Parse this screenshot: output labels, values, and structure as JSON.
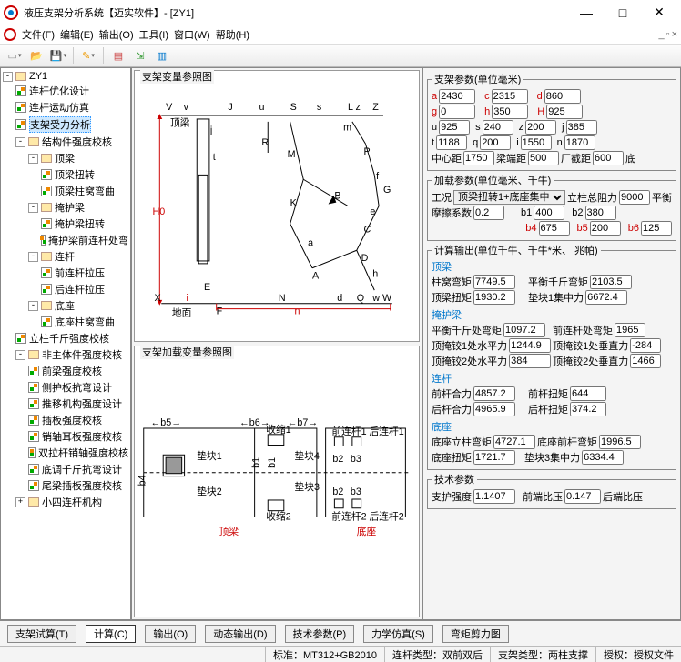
{
  "window": {
    "title": "液压支架分析系统【迈实软件】- [ZY1]"
  },
  "menu": {
    "file": "文件(F)",
    "edit": "编辑(E)",
    "output": "输出(O)",
    "tools": "工具(I)",
    "window": "窗口(W)",
    "help": "帮助(H)"
  },
  "tree": {
    "root": "ZY1",
    "n1": "连杆优化设计",
    "n2": "连杆运动仿真",
    "n3": "支架受力分析",
    "n4": "结构件强度校核",
    "n5": "顶梁",
    "n5a": "顶梁扭转",
    "n5b": "顶梁柱窝弯曲",
    "n6": "掩护梁",
    "n6a": "掩护梁扭转",
    "n6b": "掩护梁前连杆处弯",
    "n7": "连杆",
    "n7a": "前连杆拉压",
    "n7b": "后连杆拉压",
    "n8": "底座",
    "n8a": "底座柱窝弯曲",
    "n9": "立柱千斤强度校核",
    "n10": "非主体件强度校核",
    "n10a": "前梁强度校核",
    "n10b": "侧护板抗弯设计",
    "n10c": "推移机构强度设计",
    "n10d": "插板强度校核",
    "n10e": "销轴耳板强度校核",
    "n10f": "双拉杆销轴强度校核",
    "n10g": "底调千斤抗弯设计",
    "n10h": "尾梁插板强度校核",
    "n11": "小四连杆机构"
  },
  "captions": {
    "diag1": "支架变量参照图",
    "diag2": "支架加载变量参照图",
    "d1_top": "顶梁",
    "d1_bot": "地面",
    "d2a": "顶梁",
    "d2b": "底座"
  },
  "fs": {
    "p1": "支架参数(单位毫米)",
    "p2": "加载参数(单位毫米、千牛)",
    "p3": "计算输出(单位千牛、千牛*米、 兆帕)",
    "p3a": "顶梁",
    "p3b": "掩护梁",
    "p3c": "连杆",
    "p3d": "底座",
    "p4": "技术参数"
  },
  "lbl": {
    "a": "a",
    "c": "c",
    "d": "d",
    "g": "g",
    "h": "h",
    "H": "H",
    "u": "u",
    "s": "s",
    "z": "z",
    "j": "j",
    "t": "t",
    "q": "q",
    "i": "i",
    "n": "n",
    "center": "中心距",
    "beamEnd": "梁端距",
    "factoryEnd": "厂截距",
    "tail": "底",
    "cond": "工况",
    "colRes": "立柱总阻力",
    "balance": "平衡",
    "fric": "摩擦系数",
    "b1": "b1",
    "b2": "b2",
    "b4": "b4",
    "b5": "b5",
    "b6": "b6",
    "o1": "柱窝弯矩",
    "o2": "平衡千斤弯矩",
    "o3": "顶梁扭矩",
    "o4": "垫块1集中力",
    "o5": "平衡千斤处弯矩",
    "o6": "前连杆处弯矩",
    "o7": "顶掩铰1处水平力",
    "o8": "顶掩铰1处垂直力",
    "o9": "顶掩铰2处水平力",
    "o10": "顶掩铰2处垂直力",
    "o11": "前杆合力",
    "o12": "前杆扭矩",
    "o13": "后杆合力",
    "o14": "后杆扭矩",
    "o15": "底座立柱弯矩",
    "o16": "底座前杆弯矩",
    "o17": "底座扭矩",
    "o18": "垫块3集中力",
    "t1": "支护强度",
    "t2": "前端比压",
    "t3": "后端比压"
  },
  "val": {
    "a": "2430",
    "c": "2315",
    "d": "860",
    "g": "0",
    "h": "350",
    "H": "925",
    "u": "925",
    "s": "240",
    "z": "200",
    "j": "385",
    "t": "1188",
    "q": "200",
    "i": "1550",
    "n": "1870",
    "center": "1750",
    "beamEnd": "500",
    "factoryEnd": "600",
    "cond": "顶梁扭转1+底座集中",
    "colRes": "9000",
    "fric": "0.2",
    "b1": "400",
    "b2": "380",
    "b4": "675",
    "b5": "200",
    "b6": "125",
    "o1": "7749.5",
    "o2": "2103.5",
    "o3": "1930.2",
    "o4": "6672.4",
    "o5": "1097.2",
    "o6": "1965",
    "o7": "1244.9",
    "o8": "-284",
    "o9": "384",
    "o10": "1466",
    "o11": "4857.2",
    "o12": "644",
    "o13": "4965.9",
    "o14": "374.2",
    "o15": "4727.1",
    "o16": "1996.5",
    "o17": "1721.7",
    "o18": "6334.4",
    "t1": "1.1407",
    "t2": "0.147"
  },
  "btn": {
    "b1": "支架试算(T)",
    "b2": "计算(C)",
    "b3": "输出(O)",
    "b4": "动态输出(D)",
    "b5": "技术参数(P)",
    "b6": "力学仿真(S)",
    "b7": "弯矩剪力图"
  },
  "status": {
    "s1": "标准：MT312+GB2010",
    "s2": "连杆类型：双前双后",
    "s3": "支架类型：两柱支撑",
    "s4": "授权：授权文件"
  }
}
